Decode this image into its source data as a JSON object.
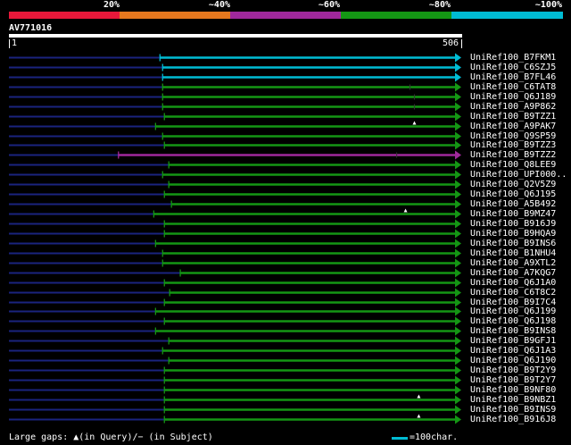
{
  "legend": {
    "segments": [
      {
        "color": "#e8183a"
      },
      {
        "color": "#e6781e"
      },
      {
        "color": "#a0289c"
      },
      {
        "color": "#149614"
      },
      {
        "color": "#00bcd4"
      }
    ],
    "percent_labels": [
      "20%",
      "~40%",
      "~60%",
      "~80%",
      "~100%"
    ]
  },
  "query": {
    "name": "AV771016",
    "start": "1",
    "end": "506"
  },
  "scale": {
    "min": 1,
    "max": 506
  },
  "hits": [
    {
      "label": "UniRef100_B7FKM1",
      "start": 172,
      "color": "#00bcd4",
      "gaps": []
    },
    {
      "label": "UniRef100_C6SZJ5",
      "start": 175,
      "color": "#00bcd4",
      "gaps": []
    },
    {
      "label": "UniRef100_B7FL46",
      "start": 175,
      "color": "#00bcd4",
      "gaps": []
    },
    {
      "label": "UniRef100_C6TAT8",
      "start": 175,
      "color": "#149614",
      "gaps": [
        {
          "pos": 455,
          "type": "subject"
        }
      ]
    },
    {
      "label": "UniRef100_Q6J189",
      "start": 175,
      "color": "#149614",
      "gaps": [
        {
          "pos": 460,
          "type": "subject"
        }
      ]
    },
    {
      "label": "UniRef100_A9P862",
      "start": 175,
      "color": "#149614",
      "gaps": [
        {
          "pos": 460,
          "type": "subject"
        }
      ]
    },
    {
      "label": "UniRef100_B9TZZ1",
      "start": 177,
      "color": "#149614",
      "gaps": []
    },
    {
      "label": "UniRef100_A9PAK7",
      "start": 167,
      "color": "#149614",
      "gaps": [
        {
          "pos": 460,
          "type": "query"
        }
      ]
    },
    {
      "label": "UniRef100_Q9SP59",
      "start": 175,
      "color": "#149614",
      "gaps": []
    },
    {
      "label": "UniRef100_B9TZZ3",
      "start": 177,
      "color": "#149614",
      "gaps": []
    },
    {
      "label": "UniRef100_B9TZZ2",
      "start": 125,
      "color": "#a0289c",
      "gaps": [
        {
          "pos": 440,
          "type": "subject"
        }
      ]
    },
    {
      "label": "UniRef100_Q8LEE9",
      "start": 182,
      "color": "#149614",
      "gaps": []
    },
    {
      "label": "UniRef100_UPI000..",
      "start": 175,
      "color": "#149614",
      "gaps": []
    },
    {
      "label": "UniRef100_Q2V5Z9",
      "start": 182,
      "color": "#149614",
      "gaps": []
    },
    {
      "label": "UniRef100_Q6J195",
      "start": 177,
      "color": "#149614",
      "gaps": []
    },
    {
      "label": "UniRef100_A5B492",
      "start": 185,
      "color": "#149614",
      "gaps": []
    },
    {
      "label": "UniRef100_B9MZ47",
      "start": 165,
      "color": "#149614",
      "gaps": [
        {
          "pos": 450,
          "type": "query"
        }
      ]
    },
    {
      "label": "UniRef100_B916J9",
      "start": 177,
      "color": "#149614",
      "gaps": []
    },
    {
      "label": "UniRef100_B9HQA9",
      "start": 177,
      "color": "#149614",
      "gaps": []
    },
    {
      "label": "UniRef100_B9INS6",
      "start": 167,
      "color": "#149614",
      "gaps": []
    },
    {
      "label": "UniRef100_B1NHU4",
      "start": 175,
      "color": "#149614",
      "gaps": []
    },
    {
      "label": "UniRef100_A9XTL2",
      "start": 175,
      "color": "#149614",
      "gaps": []
    },
    {
      "label": "UniRef100_A7KQG7",
      "start": 195,
      "color": "#149614",
      "gaps": []
    },
    {
      "label": "UniRef100_Q6J1A0",
      "start": 177,
      "color": "#149614",
      "gaps": []
    },
    {
      "label": "UniRef100_C6T8C2",
      "start": 183,
      "color": "#149614",
      "gaps": []
    },
    {
      "label": "UniRef100_B9I7C4",
      "start": 177,
      "color": "#149614",
      "gaps": []
    },
    {
      "label": "UniRef100_Q6J199",
      "start": 167,
      "color": "#149614",
      "gaps": []
    },
    {
      "label": "UniRef100_Q6J198",
      "start": 177,
      "color": "#149614",
      "gaps": []
    },
    {
      "label": "UniRef100_B9INS8",
      "start": 167,
      "color": "#149614",
      "gaps": []
    },
    {
      "label": "UniRef100_B9GFJ1",
      "start": 182,
      "color": "#149614",
      "gaps": []
    },
    {
      "label": "UniRef100_Q6J1A3",
      "start": 175,
      "color": "#149614",
      "gaps": []
    },
    {
      "label": "UniRef100_Q6J190",
      "start": 182,
      "color": "#149614",
      "gaps": []
    },
    {
      "label": "UniRef100_B9T2Y9",
      "start": 177,
      "color": "#149614",
      "gaps": []
    },
    {
      "label": "UniRef100_B9T2Y7",
      "start": 177,
      "color": "#149614",
      "gaps": []
    },
    {
      "label": "UniRef100_B9NF80",
      "start": 177,
      "color": "#149614",
      "gaps": []
    },
    {
      "label": "UniRef100_B9NBZ1",
      "start": 177,
      "color": "#149614",
      "gaps": [
        {
          "pos": 465,
          "type": "query"
        }
      ]
    },
    {
      "label": "UniRef100_B9INS9",
      "start": 177,
      "color": "#149614",
      "gaps": []
    },
    {
      "label": "UniRef100_B916J8",
      "start": 177,
      "color": "#149614",
      "gaps": [
        {
          "pos": 465,
          "type": "query"
        }
      ]
    }
  ],
  "colors": {
    "background": "#000000",
    "unaligned_line": "#1a237e",
    "text": "#ffffff"
  },
  "footer": {
    "gaps_text": "Large gaps: ▲(in Query)/− (in Subject)",
    "scale_text": "=100char."
  }
}
